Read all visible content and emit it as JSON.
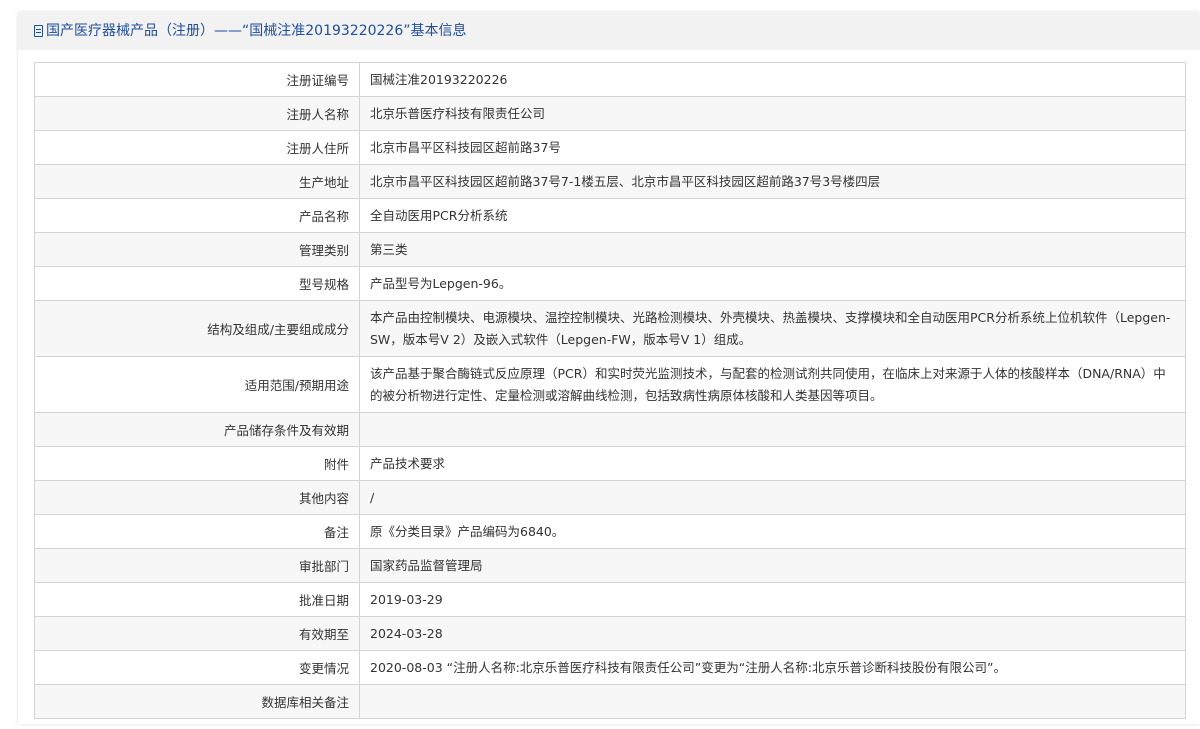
{
  "header": {
    "title": "国产医疗器械产品（注册）——“国械注准20193220226”基本信息"
  },
  "rows": [
    {
      "label": "注册证编号",
      "value": "国械注准20193220226"
    },
    {
      "label": "注册人名称",
      "value": "北京乐普医疗科技有限责任公司"
    },
    {
      "label": "注册人住所",
      "value": "北京市昌平区科技园区超前路37号"
    },
    {
      "label": "生产地址",
      "value": "北京市昌平区科技园区超前路37号7-1楼五层、北京市昌平区科技园区超前路37号3号楼四层"
    },
    {
      "label": "产品名称",
      "value": "全自动医用PCR分析系统"
    },
    {
      "label": "管理类别",
      "value": "第三类"
    },
    {
      "label": "型号规格",
      "value": "产品型号为Lepgen-96。"
    },
    {
      "label": "结构及组成/主要组成成分",
      "value": "本产品由控制模块、电源模块、温控控制模块、光路检测模块、外壳模块、热盖模块、支撑模块和全自动医用PCR分析系统上位机软件（Lepgen-SW，版本号V 2）及嵌入式软件（Lepgen-FW，版本号V 1）组成。"
    },
    {
      "label": "适用范围/预期用途",
      "value": "该产品基于聚合酶链式反应原理（PCR）和实时荧光监测技术，与配套的检测试剂共同使用，在临床上对来源于人体的核酸样本（DNA/RNA）中的被分析物进行定性、定量检测或溶解曲线检测，包括致病性病原体核酸和人类基因等项目。"
    },
    {
      "label": "产品储存条件及有效期",
      "value": ""
    },
    {
      "label": "附件",
      "value": "产品技术要求"
    },
    {
      "label": "其他内容",
      "value": "/"
    },
    {
      "label": "备注",
      "value": "原《分类目录》产品编码为6840。"
    },
    {
      "label": "审批部门",
      "value": "国家药品监督管理局"
    },
    {
      "label": "批准日期",
      "value": "2019-03-29"
    },
    {
      "label": "有效期至",
      "value": "2024-03-28"
    },
    {
      "label": "变更情况",
      "value": "2020-08-03 “注册人名称:北京乐普医疗科技有限责任公司”变更为“注册人名称:北京乐普诊断科技股份有限公司”。"
    },
    {
      "label": "数据库相关备注",
      "value": ""
    }
  ]
}
